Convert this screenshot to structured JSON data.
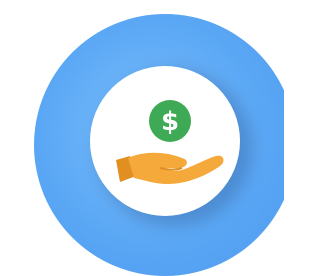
{
  "icon": {
    "name": "hand-holding-dollar-icon",
    "coin_symbol": "$"
  },
  "colors": {
    "outer_circle": "#5aa7f5",
    "inner_circle": "#ffffff",
    "coin": "#3faa55",
    "hand": "#f4a93a",
    "hand_shade": "#e08f20"
  }
}
